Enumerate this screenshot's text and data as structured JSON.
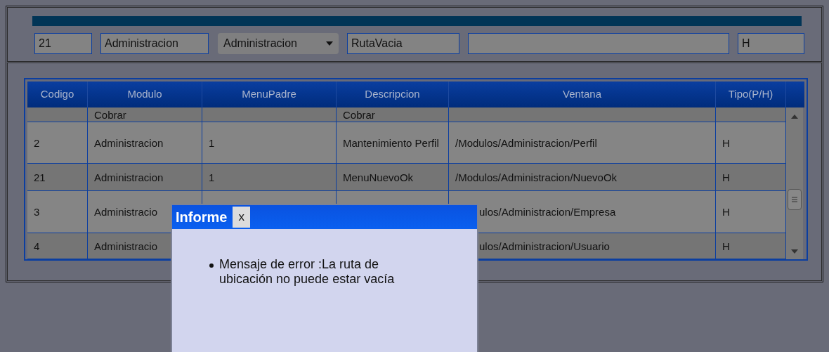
{
  "form": {
    "fields": [
      {
        "kind": "input",
        "value": "21"
      },
      {
        "kind": "input",
        "value": "Administracion"
      },
      {
        "kind": "select",
        "value": "Administracion"
      },
      {
        "kind": "input",
        "value": "RutaVacia"
      },
      {
        "kind": "input"
      },
      {
        "kind": "input",
        "value": "H"
      }
    ]
  },
  "table": {
    "columns": [
      "Codigo",
      "Modulo",
      "MenuPadre",
      "Descripcion",
      "Ventana",
      "Tipo(P/H)"
    ],
    "rows": [
      {
        "kind": "plain",
        "modulo": "Cobrar",
        "descripcion": "Cobrar"
      },
      {
        "kind": "plain",
        "codigo": "2",
        "modulo": "Administracion",
        "menupadre": "1",
        "descripcion": "Mantenimiento Perfil",
        "ventana": "/Modulos/Administracion/Perfil",
        "tipo": "H"
      },
      {
        "kind": "plain",
        "codigo": "21",
        "modulo": "Administracion",
        "menupadre": "1",
        "descripcion": "MenuNuevoOk",
        "ventana": "/Modulos/Administracion/NuevoOk",
        "tipo": "H"
      },
      {
        "kind": "covered",
        "codigo": "3",
        "modulo": "Administracio",
        "ventana": "ulos/Administracion/Empresa",
        "tipo": "H"
      },
      {
        "kind": "covered",
        "codigo": "4",
        "modulo": "Administracio",
        "ventana": "ulos/Administracion/Usuario",
        "tipo": "H"
      }
    ]
  },
  "dialog": {
    "title": "Informe",
    "close": "x",
    "messages": [
      "Mensaje de error :La ruta de ubicación no puede estar vacía"
    ]
  }
}
